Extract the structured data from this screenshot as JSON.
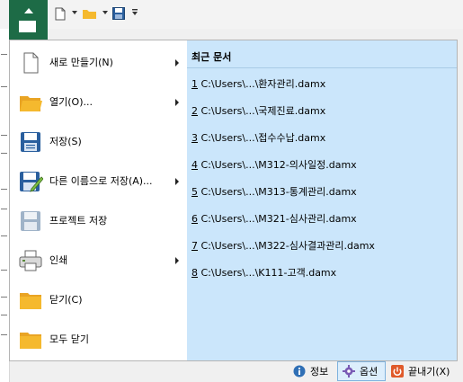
{
  "menu_items": [
    {
      "label": "새로 만들기(N)",
      "icon": "new-file-icon",
      "submenu": true
    },
    {
      "label": "열기(O)...",
      "icon": "open-folder-icon",
      "submenu": true
    },
    {
      "label": "저장(S)",
      "icon": "save-icon",
      "submenu": false
    },
    {
      "label": "다른 이름으로 저장(A)...",
      "icon": "save-as-icon",
      "submenu": true
    },
    {
      "label": "프로젝트 저장",
      "icon": "save-project-icon",
      "submenu": false
    },
    {
      "label": "인쇄",
      "icon": "print-icon",
      "submenu": true
    },
    {
      "label": "닫기(C)",
      "icon": "close-folder-icon",
      "submenu": false
    },
    {
      "label": "모두 닫기",
      "icon": "close-all-folder-icon",
      "submenu": false
    }
  ],
  "recent": {
    "title": "최근 문서",
    "files": [
      {
        "num": "1",
        "path": " C:\\Users\\...\\환자관리.damx"
      },
      {
        "num": "2",
        "path": " C:\\Users\\...\\국제진료.damx"
      },
      {
        "num": "3",
        "path": " C:\\Users\\...\\접수수납.damx"
      },
      {
        "num": "4",
        "path": " C:\\Users\\...\\M312-의사일정.damx"
      },
      {
        "num": "5",
        "path": " C:\\Users\\...\\M313-통계관리.damx"
      },
      {
        "num": "6",
        "path": " C:\\Users\\...\\M321-심사관리.damx"
      },
      {
        "num": "7",
        "path": " C:\\Users\\...\\M322-심사결과관리.damx"
      },
      {
        "num": "8",
        "path": " C:\\Users\\...\\K111-고객.damx"
      }
    ]
  },
  "bottom": {
    "info": "정보",
    "options": "옵션",
    "exit": "끝내기(X)"
  },
  "colors": {
    "app_button": "#1d6b46",
    "recent_bg": "#cbe6fb",
    "folder": "#f5b92e",
    "save_blue": "#2a5f9e"
  }
}
